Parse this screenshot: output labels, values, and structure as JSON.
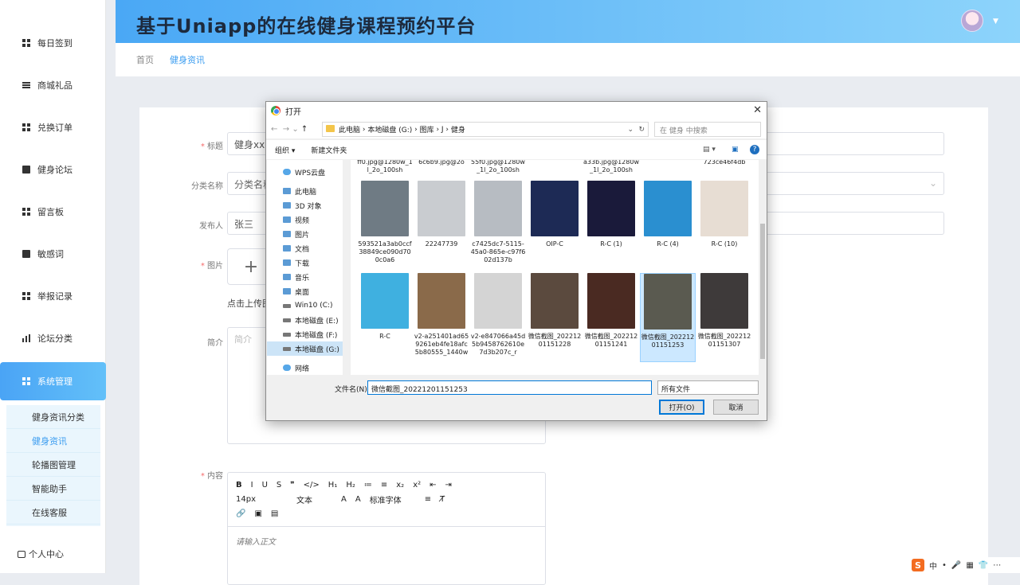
{
  "app": {
    "title": "基于Uniapp的在线健身课程预约平台"
  },
  "sidebar": {
    "items": [
      {
        "label": "每日签到",
        "icon": "grid-icon"
      },
      {
        "label": "商城礼品",
        "icon": "list-icon"
      },
      {
        "label": "兑换订单",
        "icon": "grid-icon"
      },
      {
        "label": "健身论坛",
        "icon": "doc-icon"
      },
      {
        "label": "留言板",
        "icon": "grid-icon"
      },
      {
        "label": "敏感词",
        "icon": "doc-icon"
      },
      {
        "label": "举报记录",
        "icon": "grid-icon"
      },
      {
        "label": "论坛分类",
        "icon": "bars-icon"
      },
      {
        "label": "系统管理",
        "icon": "grid-icon"
      }
    ],
    "subitems": [
      {
        "label": "健身资讯分类"
      },
      {
        "label": "健身资讯"
      },
      {
        "label": "轮播图管理"
      },
      {
        "label": "智能助手"
      },
      {
        "label": "在线客服"
      }
    ],
    "user_center": "个人中心"
  },
  "breadcrumb": {
    "home": "首页",
    "current": "健身资讯"
  },
  "form": {
    "title_label": "标题",
    "title_value": "健身xx、",
    "category_label": "分类名称",
    "category_value": "分类名称",
    "publisher_label": "发布人",
    "publisher_value": "张三",
    "image_label": "图片",
    "upload_plus": "+",
    "upload_hint": "点击上传图",
    "intro_label": "简介",
    "intro_placeholder": "简介",
    "content_label": "内容",
    "content_placeholder": "请输入正文",
    "required_mark": "*"
  },
  "editor": {
    "row1": [
      "B",
      "I",
      "U",
      "S",
      "❞",
      "</>",
      "H₁",
      "H₂",
      "≔",
      "≡",
      "x₂",
      "x²",
      "⇤",
      "⇥"
    ],
    "font_size": "14px",
    "text_style": "文本",
    "font_family": "标准字体",
    "row3": [
      "🔗",
      "▣",
      "▤"
    ]
  },
  "dialog": {
    "title": "打开",
    "address": [
      "此电脑",
      "本地磁盘 (G:)",
      "图库",
      "J",
      "健身"
    ],
    "search_placeholder": "在 健身 中搜索",
    "organize": "组织 ▾",
    "new_folder": "新建文件夹",
    "nav": [
      {
        "label": "WPS云盘",
        "icon": "cloud"
      },
      {
        "label": "此电脑",
        "icon": "pc"
      },
      {
        "label": "3D 对象",
        "icon": "pc"
      },
      {
        "label": "视频",
        "icon": "pc"
      },
      {
        "label": "图片",
        "icon": "pc"
      },
      {
        "label": "文档",
        "icon": "pc"
      },
      {
        "label": "下载",
        "icon": "pc"
      },
      {
        "label": "音乐",
        "icon": "pc"
      },
      {
        "label": "桌面",
        "icon": "pc"
      },
      {
        "label": "Win10 (C:)",
        "icon": "drive"
      },
      {
        "label": "本地磁盘 (E:)",
        "icon": "drive"
      },
      {
        "label": "本地磁盘 (F:)",
        "icon": "drive"
      },
      {
        "label": "本地磁盘 (G:)",
        "icon": "drive",
        "selected": true
      },
      {
        "label": "网络",
        "icon": "cloud"
      }
    ],
    "top_partial": [
      "ff0.jpg@1280w_1l_2o_100sh",
      "6c6b9.jpg@2o",
      "55f0.jpg@1280w_1l_2o_100sh",
      "",
      "a33b.jpg@1280w_1l_2o_100sh",
      "",
      "723ce46f4db"
    ],
    "files": [
      {
        "name": "593521a3ab0ccf38849ce090d700c0a6",
        "color": "#6f7b84"
      },
      {
        "name": "22247739",
        "color": "#c9ccd0"
      },
      {
        "name": "c7425dc7-5115-45a0-865e-c97f602d137b",
        "color": "#b7bcc2"
      },
      {
        "name": "OIP-C",
        "color": "#1d2a55"
      },
      {
        "name": "R-C (1)",
        "color": "#1a1a3a"
      },
      {
        "name": "R-C (4)",
        "color": "#2a8fd0"
      },
      {
        "name": "R-C (10)",
        "color": "#e7ddd3"
      },
      {
        "name": "R-C",
        "color": "#3fb0e0"
      },
      {
        "name": "v2-a251401ad659261eb4fe18afc5b80555_1440w",
        "color": "#8a6a4a"
      },
      {
        "name": "v2-e847066a45d5b9458762610e7d3b207c_r",
        "color": "#d4d4d4"
      },
      {
        "name": "微信截图_20221201151228",
        "color": "#5b4a3e"
      },
      {
        "name": "微信截图_20221201151241",
        "color": "#4a2a22"
      },
      {
        "name": "微信截图_20221201151253",
        "color": "#5a5a50",
        "selected": true
      },
      {
        "name": "微信截图_20221201151307",
        "color": "#3e3a3a"
      }
    ],
    "filename_label": "文件名(N):",
    "filename_value": "微信截图_20221201151253",
    "filetype": "所有文件",
    "open_button": "打开(O)",
    "cancel_button": "取消"
  },
  "tray": [
    "中",
    "•",
    "🎤",
    "▦",
    "👕",
    "⋯"
  ],
  "colors": {
    "accent": "#3a9cf0",
    "header_start": "#4aa8f5",
    "header_end": "#8dd4fb"
  }
}
